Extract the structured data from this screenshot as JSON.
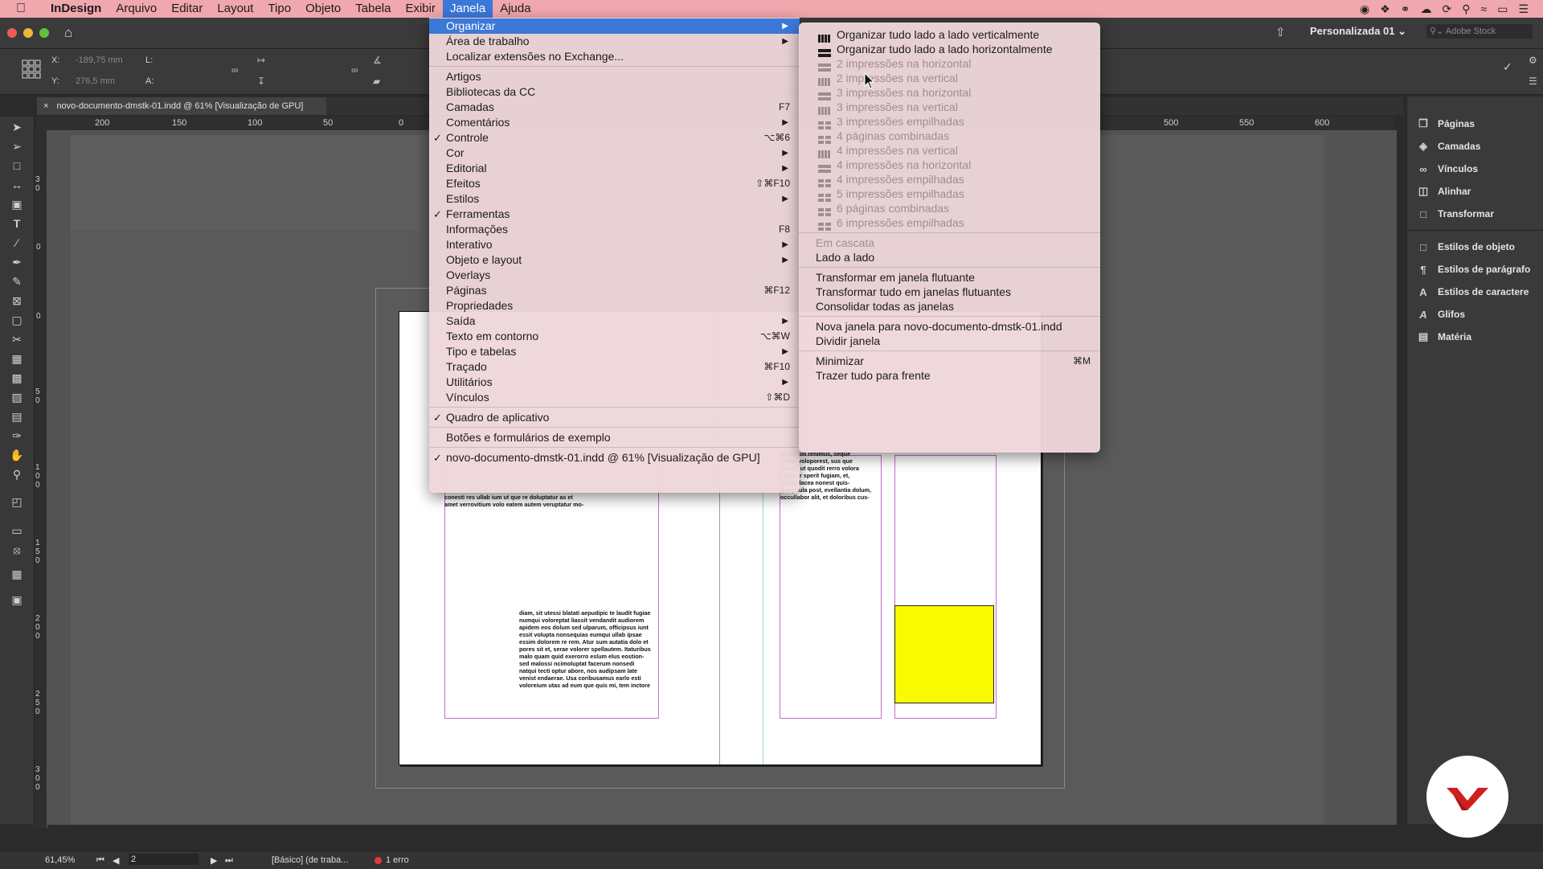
{
  "menubar": {
    "app_name": "InDesign",
    "items": [
      "Arquivo",
      "Editar",
      "Layout",
      "Tipo",
      "Objeto",
      "Tabela",
      "Exibir",
      "Janela",
      "Ajuda"
    ],
    "active": "Janela"
  },
  "titlebar": {
    "workspace": "Personalizada 01",
    "search_placeholder": "Adobe Stock"
  },
  "controlbar": {
    "x_label": "X:",
    "x_value": "-189,75 mm",
    "y_label": "Y:",
    "y_value": "276,5 mm",
    "w_label": "L:",
    "h_label": "A:"
  },
  "document_tab": {
    "title": "novo-documento-dmstk-01.indd @ 61% [Visualização de GPU]"
  },
  "hruler_ticks": [
    "200",
    "150",
    "100",
    "50",
    "0",
    "500",
    "550",
    "600"
  ],
  "vruler_ticks": [
    "3 0",
    "0",
    "0",
    "5 0",
    "1 0 0",
    "1 5 0",
    "2 0 0",
    "2 5 0",
    "3 0 0"
  ],
  "janela_menu": {
    "items": [
      {
        "label": "Organizar",
        "submenu": true,
        "highlighted": true
      },
      {
        "label": "Área de trabalho",
        "submenu": true
      },
      {
        "label": "Localizar extensões no Exchange..."
      },
      {
        "separator": true
      },
      {
        "label": "Artigos"
      },
      {
        "label": "Bibliotecas da CC"
      },
      {
        "label": "Camadas",
        "shortcut": "F7"
      },
      {
        "label": "Comentários",
        "submenu": true
      },
      {
        "label": "Controle",
        "checked": true,
        "shortcut": "⌥⌘6"
      },
      {
        "label": "Cor",
        "submenu": true
      },
      {
        "label": "Editorial",
        "submenu": true
      },
      {
        "label": "Efeitos",
        "shortcut": "⇧⌘F10"
      },
      {
        "label": "Estilos",
        "submenu": true
      },
      {
        "label": "Ferramentas",
        "checked": true
      },
      {
        "label": "Informações",
        "shortcut": "F8"
      },
      {
        "label": "Interativo",
        "submenu": true
      },
      {
        "label": "Objeto e layout",
        "submenu": true
      },
      {
        "label": "Overlays"
      },
      {
        "label": "Páginas",
        "shortcut": "⌘F12"
      },
      {
        "label": "Propriedades"
      },
      {
        "label": "Saída",
        "submenu": true
      },
      {
        "label": "Texto em contorno",
        "shortcut": "⌥⌘W"
      },
      {
        "label": "Tipo e tabelas",
        "submenu": true
      },
      {
        "label": "Traçado",
        "shortcut": "⌘F10"
      },
      {
        "label": "Utilitários",
        "submenu": true
      },
      {
        "label": "Vínculos",
        "shortcut": "⇧⌘D"
      },
      {
        "separator": true
      },
      {
        "label": "Quadro de aplicativo",
        "checked": true
      },
      {
        "separator": true
      },
      {
        "label": "Botões e formulários de exemplo"
      },
      {
        "separator": true
      },
      {
        "label": "novo-documento-dmstk-01.indd @ 61% [Visualização de GPU]",
        "checked": true
      }
    ]
  },
  "organizar_menu": {
    "items": [
      {
        "label": "Organizar tudo lado a lado verticalmente",
        "icon": "vertical"
      },
      {
        "label": "Organizar tudo lado a lado horizontalmente",
        "icon": "horizontal"
      },
      {
        "label": "2 impressões na horizontal",
        "icon": "horizontal",
        "disabled": true
      },
      {
        "label": "2 impressões na vertical",
        "icon": "vertical",
        "disabled": true
      },
      {
        "label": "3 impressões na horizontal",
        "icon": "horizontal",
        "disabled": true
      },
      {
        "label": "3 impressões na vertical",
        "icon": "vertical",
        "disabled": true
      },
      {
        "label": "3 impressões empilhadas",
        "icon": "grid",
        "disabled": true
      },
      {
        "label": "4 páginas combinadas",
        "icon": "grid",
        "disabled": true
      },
      {
        "label": "4 impressões na vertical",
        "icon": "vertical",
        "disabled": true
      },
      {
        "label": "4 impressões na horizontal",
        "icon": "horizontal",
        "disabled": true
      },
      {
        "label": "4 impressões empilhadas",
        "icon": "grid",
        "disabled": true
      },
      {
        "label": "5 impressões empilhadas",
        "icon": "grid",
        "disabled": true
      },
      {
        "label": "6 páginas combinadas",
        "icon": "grid",
        "disabled": true
      },
      {
        "label": "6 impressões empilhadas",
        "icon": "grid",
        "disabled": true
      },
      {
        "separator": true
      },
      {
        "label": "Em cascata",
        "disabled": true
      },
      {
        "label": "Lado a lado"
      },
      {
        "separator": true
      },
      {
        "label": "Transformar em janela flutuante"
      },
      {
        "label": "Transformar tudo em janelas flutuantes"
      },
      {
        "label": "Consolidar todas as janelas"
      },
      {
        "separator": true
      },
      {
        "label": "Nova janela para novo-documento-dmstk-01.indd"
      },
      {
        "label": "Dividir janela"
      },
      {
        "separator": true
      },
      {
        "label": "Minimizar",
        "shortcut": "⌘M"
      },
      {
        "label": "Trazer tudo para frente"
      }
    ]
  },
  "right_panel": {
    "group1": [
      "Páginas",
      "Camadas",
      "Vínculos",
      "Alinhar",
      "Transformar"
    ],
    "group2": [
      "Estilos de objeto",
      "Estilos de parágrafo",
      "Estilos de caractere",
      "Glifos",
      "Matéria"
    ]
  },
  "statusbar": {
    "zoom": "61,45%",
    "page": "2",
    "profile": "[Básico] (de traba...",
    "errors": "1 erro"
  },
  "page_text": {
    "left_fragment": "conesti res ullab ium ut que re doluptatur as et\namet verrovitium volo eatem autem veruptatur mo-",
    "left_block": "diam, sit utessi blatati aepudipic te laudit fugiae\nnumqui voloreptat liassit vendandit audiorem\napidem eos dolum sed ulparum, officipsus iunt\nessit volupta nonsequias eumqui ullab ipsae\nessim dolorem re rem. Atur sum autatia dolo et\npores sit et, serae volorer spellautem. Itaturibus\nmalo quam quid exerorro eslum elus eostion-\nsed malossi ncimoluptat facerum nonsedi\nnatqui tecti optur abore, nos audipsam late\nvenist endaerae. Usa coribusamus earlo esti\nvoloreium utas ad eum que quis mi, tem inctore",
    "right_fragment": "hinitatum renimus, seque\naecae voloporest, sus que\nuccus, ut quodit rerro volora\nt atiorer sperit fugiam, et,\nut laut lacea nonest quis-\nque paula post, evellantia dolum,\noccullabor alit, et doloribus cus-"
  },
  "colors": {
    "menubar_bg": "#f0a7ad",
    "highlight": "#3b78d8",
    "yellow_box": "#fbfb00"
  }
}
